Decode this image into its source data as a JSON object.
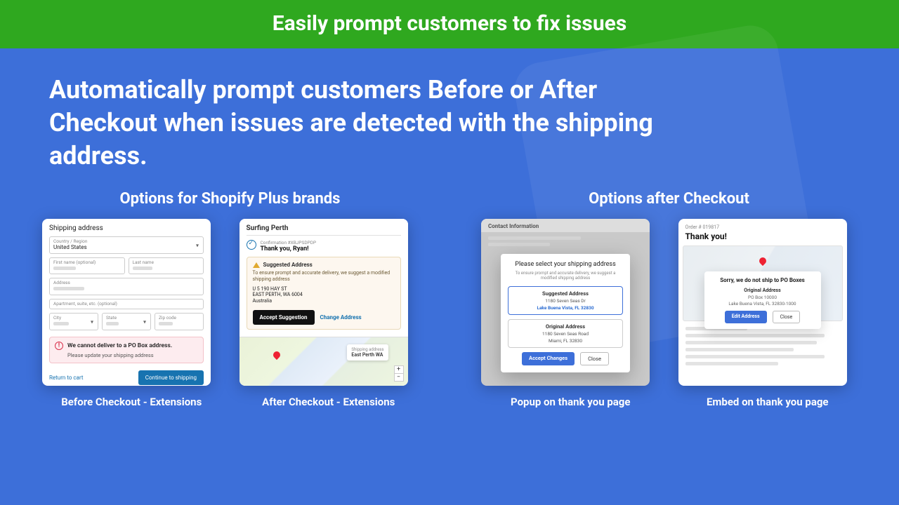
{
  "banner": "Easily prompt customers to fix issues",
  "headline": "Automatically prompt customers Before or After Checkout when issues are detected with the shipping address.",
  "left": {
    "title": "Options for Shopify Plus brands",
    "card1": {
      "heading": "Shipping address",
      "country_label": "Country / Region",
      "country_value": "United States",
      "first_label": "First name (optional)",
      "last_label": "Last name",
      "address_label": "Address",
      "apt_label": "Apartment, suite, etc. (optional)",
      "city_label": "City",
      "state_label": "State",
      "zip_label": "Zip code",
      "alert_title": "We cannot deliver to a PO Box address.",
      "alert_sub": "Please update your shipping address",
      "return": "Return to cart",
      "continue": "Continue to shipping",
      "caption": "Before Checkout - Extensions"
    },
    "card2": {
      "store": "Surfing Perth",
      "conf": "Confirmation #XBJPSDPDP",
      "thankyou": "Thank you, Ryan!",
      "box_title": "Suggested Address",
      "box_sub": "To ensure prompt and accurate delivery, we suggest a modified shipping address",
      "addr1": "U 5 190 HAY ST",
      "addr2": "EAST PERTH, WA 6004",
      "addr3": "Australia",
      "accept": "Accept Suggestion",
      "change": "Change Address",
      "map_label": "Shipping address",
      "map_city": "East Perth WA",
      "caption": "After Checkout - Extensions"
    }
  },
  "right": {
    "title": "Options after Checkout",
    "card3": {
      "bg_heading": "Contact Information",
      "modal_title": "Please select your shipping address",
      "modal_sub": "To ensure prompt and accurate delivery, we suggest a modified shipping address",
      "suggested_h": "Suggested Address",
      "suggested_a1": "1180 Seven Seas Dr",
      "suggested_a2": "Lake Buena Vista, FL 32830",
      "original_h": "Original Address",
      "original_a1": "1180 Seven Seas Road",
      "original_a2": "Miami, FL 32830",
      "accept": "Accept Changes",
      "close": "Close",
      "caption": "Popup on thank you page"
    },
    "card4": {
      "order": "Order # 019817",
      "thankyou": "Thank you!",
      "sorry": "Sorry, we do not ship to PO Boxes",
      "original_h": "Original Address",
      "addr1": "PO Box 10000",
      "addr2": "Lake Buena Vista, FL 32830-1000",
      "edit": "Edit Address",
      "close": "Close",
      "caption": "Embed on thank you page"
    }
  }
}
